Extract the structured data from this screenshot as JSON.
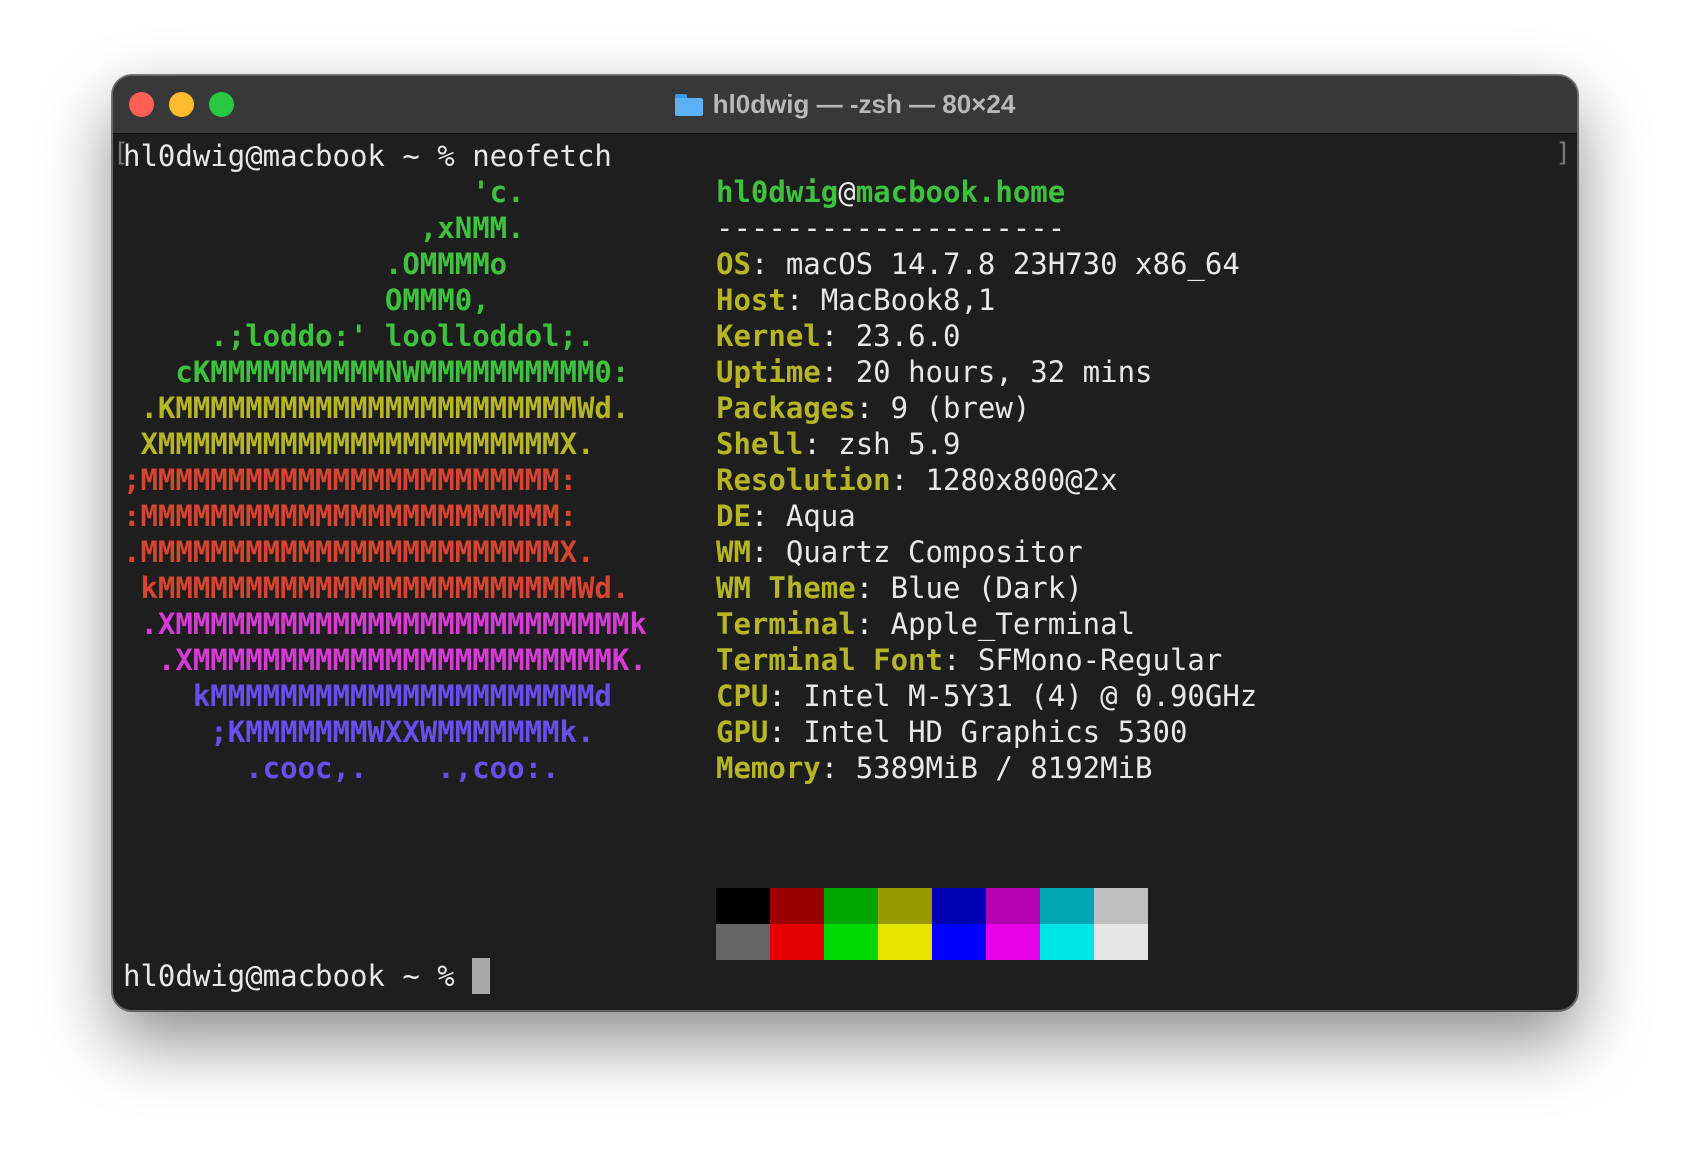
{
  "window": {
    "title": "hl0dwig — -zsh — 80×24"
  },
  "terminal": {
    "first_prompt": "hl0dwig@macbook ~ % ",
    "command": "neofetch",
    "last_prompt": "hl0dwig@macbook ~ % ",
    "bracket_left": "[",
    "bracket_right": "]"
  },
  "logo": [
    {
      "text": "                    'c.",
      "color": "#3ec23e"
    },
    {
      "text": "                 ,xNMM.",
      "color": "#3ec23e"
    },
    {
      "text": "               .OMMMMo",
      "color": "#3ec23e"
    },
    {
      "text": "               OMMM0,",
      "color": "#3ec23e"
    },
    {
      "text": "     .;loddo:' loolloddol;.",
      "color": "#3ec23e"
    },
    {
      "text": "   cKMMMMMMMMMMNWMMMMMMMMMM0:",
      "color": "#3ec23e"
    },
    {
      "text": " .KMMMMMMMMMMMMMMMMMMMMMMMWd.",
      "color": "#b5b525"
    },
    {
      "text": " XMMMMMMMMMMMMMMMMMMMMMMMX.",
      "color": "#b5b525"
    },
    {
      "text": ";MMMMMMMMMMMMMMMMMMMMMMMM:",
      "color": "#d8442f"
    },
    {
      "text": ":MMMMMMMMMMMMMMMMMMMMMMMM:",
      "color": "#d8442f"
    },
    {
      "text": ".MMMMMMMMMMMMMMMMMMMMMMMMX.",
      "color": "#d8442f"
    },
    {
      "text": " kMMMMMMMMMMMMMMMMMMMMMMMMWd.",
      "color": "#d8442f"
    },
    {
      "text": " .XMMMMMMMMMMMMMMMMMMMMMMMMMMk",
      "color": "#d83ad8"
    },
    {
      "text": "  .XMMMMMMMMMMMMMMMMMMMMMMMMK.",
      "color": "#d83ad8"
    },
    {
      "text": "    kMMMMMMMMMMMMMMMMMMMMMMd",
      "color": "#6a4ef0"
    },
    {
      "text": "     ;KMMMMMMMWXXWMMMMMMMk.",
      "color": "#6a4ef0"
    },
    {
      "text": "       .cooc,.    .,coo:.",
      "color": "#6a4ef0"
    }
  ],
  "info": {
    "user": "hl0dwig",
    "at": "@",
    "host": "macbook.home",
    "separator": "--------------------",
    "rows": [
      {
        "key": "OS",
        "value": "macOS 14.7.8 23H730 x86_64"
      },
      {
        "key": "Host",
        "value": "MacBook8,1"
      },
      {
        "key": "Kernel",
        "value": "23.6.0"
      },
      {
        "key": "Uptime",
        "value": "20 hours, 32 mins"
      },
      {
        "key": "Packages",
        "value": "9 (brew)"
      },
      {
        "key": "Shell",
        "value": "zsh 5.9"
      },
      {
        "key": "Resolution",
        "value": "1280x800@2x"
      },
      {
        "key": "DE",
        "value": "Aqua"
      },
      {
        "key": "WM",
        "value": "Quartz Compositor"
      },
      {
        "key": "WM Theme",
        "value": "Blue (Dark)"
      },
      {
        "key": "Terminal",
        "value": "Apple_Terminal"
      },
      {
        "key": "Terminal Font",
        "value": "SFMono-Regular"
      },
      {
        "key": "CPU",
        "value": "Intel M-5Y31 (4) @ 0.90GHz"
      },
      {
        "key": "GPU",
        "value": "Intel HD Graphics 5300"
      },
      {
        "key": "Memory",
        "value": "5389MiB / 8192MiB"
      }
    ]
  },
  "palette": {
    "normal": [
      "#000000",
      "#990000",
      "#00a600",
      "#999900",
      "#0000b2",
      "#b200b2",
      "#00a6b2",
      "#bfbfbf"
    ],
    "bright": [
      "#666666",
      "#e50000",
      "#00d900",
      "#e5e500",
      "#0000ff",
      "#e500e5",
      "#00e5e5",
      "#e5e5e5"
    ]
  }
}
